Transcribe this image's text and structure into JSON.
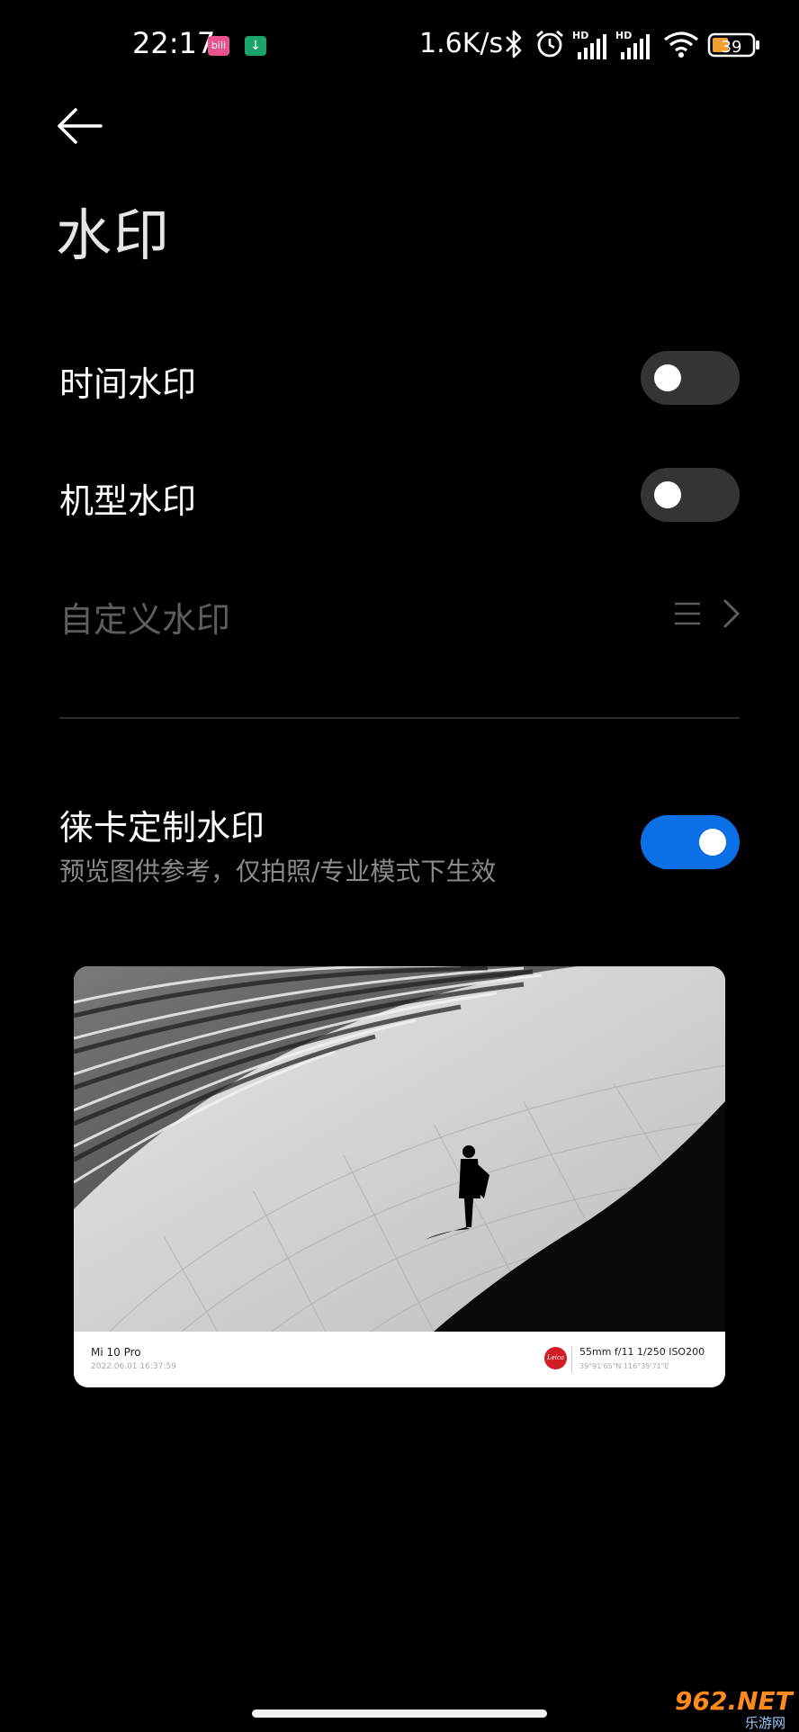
{
  "status_bar": {
    "time": "22:17",
    "notif_1": "bili",
    "notif_2": "↓",
    "net_speed": "1.6K/s",
    "battery": "39",
    "icons": [
      "bluetooth-icon",
      "alarm-icon",
      "signal-hd-icon",
      "signal-hd-icon",
      "wifi-icon",
      "battery-icon"
    ]
  },
  "header": {
    "title": "水印"
  },
  "settings": {
    "time_watermark": {
      "label": "时间水印",
      "enabled": false
    },
    "model_watermark": {
      "label": "机型水印",
      "enabled": false
    },
    "custom_watermark": {
      "label": "自定义水印",
      "disabled": true,
      "trailing_icons": [
        "menu-lines-icon",
        "chevron-right-icon"
      ]
    },
    "leica_watermark": {
      "label": "徕卡定制水印",
      "subtitle": "预览图供参考，仅拍照/专业模式下生效",
      "enabled": true
    }
  },
  "preview": {
    "model": "Mi 10 Pro",
    "date": "2022.06.01 16:37:59",
    "logo": "Leica",
    "exif": "55mm  f/11  1/250  ISO200",
    "gps": "39°91'65\"N  116°39'71\"E"
  },
  "footer_badge": {
    "main": "962.NET",
    "sub": "乐游网"
  },
  "colors": {
    "background": "#000000",
    "toggle_on": "#0b6fe6",
    "toggle_off": "#343434",
    "disabled_text": "#5d5d5d",
    "subtitle_text": "#8a8a8a"
  }
}
